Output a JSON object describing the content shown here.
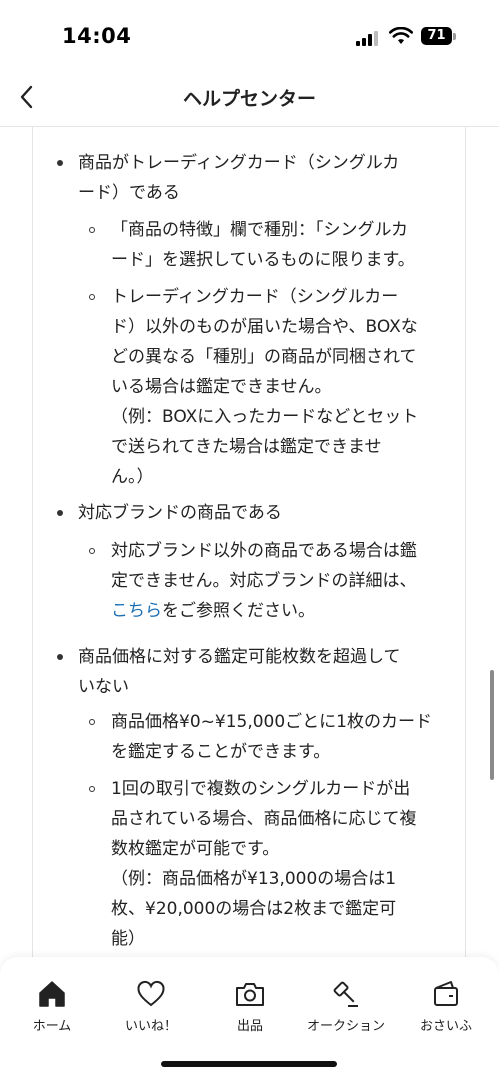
{
  "status": {
    "time": "14:04",
    "battery": "71"
  },
  "header": {
    "title": "ヘルプセンター",
    "back_icon": "chevron-left-icon"
  },
  "content": {
    "item1": {
      "lines": [
        "商品がトレーディングカード（シングルカ",
        "ード）である"
      ],
      "sub1": [
        "「商品の特徴」欄で種別：「シングルカ",
        "ード」を選択しているものに限ります。"
      ],
      "sub2": [
        "トレーディングカード（シングルカー",
        "ド）以外のものが届いた場合や、BOXな",
        "どの異なる「種別」の商品が同梱されて",
        "いる場合は鑑定できません。",
        "（例：BOXに入ったカードなどとセット",
        "で送られてきた場合は鑑定できませ",
        "ん。）"
      ]
    },
    "item2": {
      "lines": [
        "対応ブランドの商品である"
      ],
      "sub1_lines": [
        "対応ブランド以外の商品である場合は鑑",
        "定できません。対応ブランドの詳細は、"
      ],
      "sub1_link": "こちら",
      "sub1_after": "をご参照ください。"
    },
    "item3": {
      "lines": [
        "商品価格に対する鑑定可能枚数を超過して",
        "いない"
      ],
      "sub1": [
        "商品価格¥0~¥15,000ごとに1枚のカード",
        "を鑑定することができます。"
      ],
      "sub2": [
        "1回の取引で複数のシングルカードが出",
        "品されている場合、商品価格に応じて複",
        "数枚鑑定が可能です。",
        "（例：商品価格が¥13,000の場合は1",
        "枚、¥20,000の場合は2枚まで鑑定可",
        "能）"
      ]
    }
  },
  "tabs": [
    {
      "label": "ホーム",
      "icon": "home-icon"
    },
    {
      "label": "いいね！",
      "icon": "heart-icon"
    },
    {
      "label": "出品",
      "icon": "camera-icon"
    },
    {
      "label": "オークション",
      "icon": "gavel-icon"
    },
    {
      "label": "おさいふ",
      "icon": "wallet-icon"
    }
  ],
  "colors": {
    "link": "#1a6fb5",
    "text": "#222222"
  }
}
